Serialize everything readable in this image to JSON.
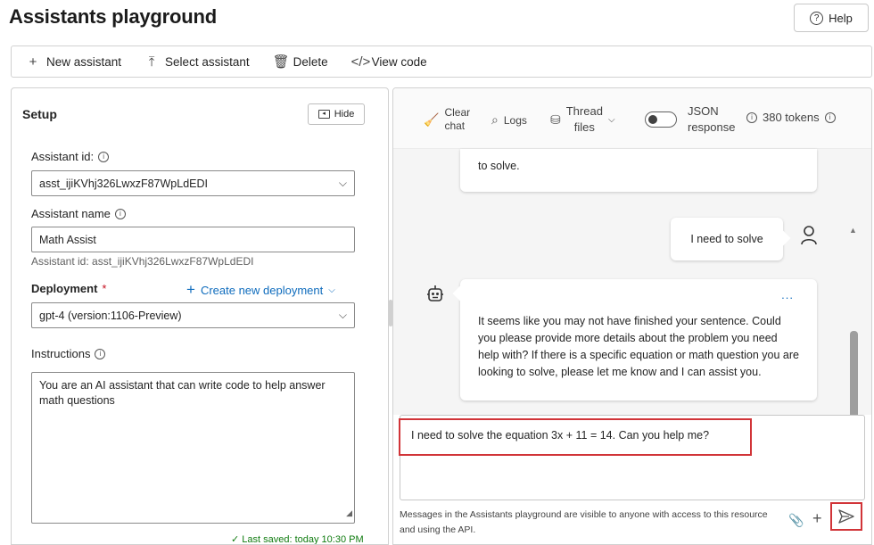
{
  "page": {
    "title": "Assistants playground",
    "help_label": "Help"
  },
  "toolbar": {
    "new_assistant": "New assistant",
    "select_assistant": "Select assistant",
    "delete": "Delete",
    "view_code": "View code"
  },
  "setup": {
    "title": "Setup",
    "hide_label": "Hide",
    "assistant_id_label": "Assistant id:",
    "assistant_id_value": "asst_ijiKVhj326LwxzF87WpLdEDI",
    "assistant_name_label": "Assistant name",
    "assistant_name_value": "Math Assist",
    "assistant_id_note": "Assistant id: asst_ijiKVhj326LwxzF87WpLdEDI",
    "deployment_label": "Deployment",
    "required_mark": "*",
    "create_deployment": "Create new deployment",
    "deployment_value": "gpt-4 (version:1106-Preview)",
    "instructions_label": "Instructions",
    "instructions_value": "You are an AI assistant that can write code to help answer math questions",
    "last_saved": "✓ Last saved: today 10:30 PM"
  },
  "chat_toolbar": {
    "clear_line1": "Clear",
    "clear_line2": "chat",
    "logs": "Logs",
    "thread_line1": "Thread",
    "thread_line2": "files",
    "json_line1": "JSON",
    "json_line2": "response",
    "tokens": "380 tokens"
  },
  "messages": {
    "prev_tail": "to solve.",
    "user_msg": "I need to solve",
    "assistant_msg": "It seems like you may not have finished your sentence. Could you please provide more details about the problem you need help with? If there is a specific equation or math question you are looking to solve, please let me know and I can assist you.",
    "more_dots": "..."
  },
  "composer": {
    "input_value": "I need to solve the equation 3x + 11 = 14. Can you help me?",
    "disclaimer": "Messages in the Assistants playground are visible to anyone with access to this resource and using the API."
  },
  "colors": {
    "accent": "#0f6cbd",
    "highlight": "#d13438",
    "saved": "#107c10"
  }
}
